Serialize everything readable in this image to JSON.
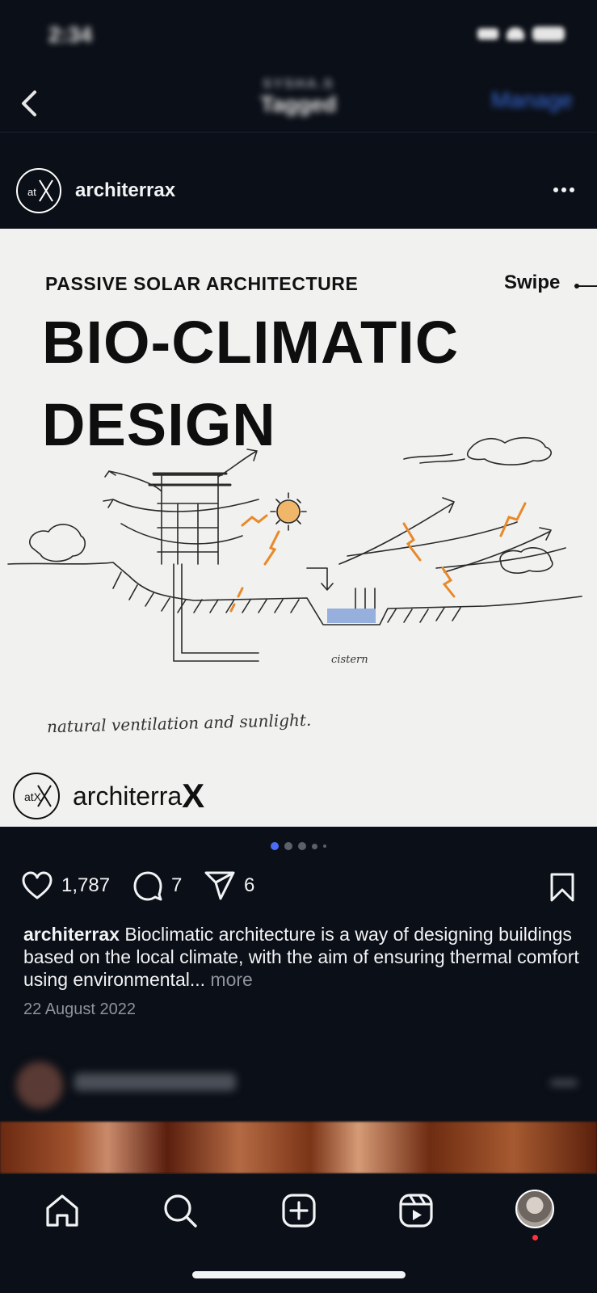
{
  "status_bar": {
    "time": "2:34"
  },
  "header": {
    "subtitle": "SYSHA.S",
    "title": "Tagged",
    "manage_label": "Manage"
  },
  "post": {
    "username": "architerrax",
    "logo_text": "atX",
    "image": {
      "kicker": "PASSIVE SOLAR ARCHITECTURE",
      "swipe_label": "Swipe",
      "title_line1": "BIO-CLIMATIC",
      "title_line2": "DESIGN",
      "sketch_label": "cistern",
      "sketch_caption": "natural ventilation and sunlight.",
      "brand_logo": "atX",
      "brand_name": "architerra",
      "brand_x": "X"
    },
    "carousel": {
      "count": 5,
      "active_index": 0
    },
    "likes": "1,787",
    "comments": "7",
    "shares": "6",
    "caption_username": "architerrax",
    "caption_text": "Bioclimatic architecture is a way of designing buildings based on the local climate, with the aim of ensuring thermal comfort using environmental...",
    "caption_more": "more",
    "date": "22 August 2022"
  },
  "next_post": {
    "username": "avantika__cool"
  },
  "tabbar": [
    "home-icon",
    "search-icon",
    "create-icon",
    "reels-icon",
    "profile-avatar"
  ],
  "colors": {
    "background": "#0b0f17",
    "accent_blue": "#3b6ee0",
    "carousel_active": "#4a6cf7",
    "notification": "#ff3040"
  }
}
